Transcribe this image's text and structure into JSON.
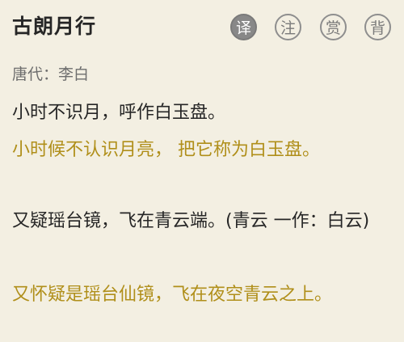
{
  "poem": {
    "title": "古朗月行",
    "author_line": "唐代：李白"
  },
  "actions": {
    "translate": "译",
    "annotate": "注",
    "appreciate": "赏",
    "recite": "背"
  },
  "stanzas": [
    {
      "verse": "小时不识月，呼作白玉盘。",
      "translation": "小时候不认识月亮， 把它称为白玉盘。"
    },
    {
      "verse": "又疑瑶台镜，飞在青云端。(青云 一作：白云)",
      "translation": "又怀疑是瑶台仙镜，飞在夜空青云之上。"
    }
  ],
  "colors": {
    "background": "#f3efe2",
    "translation_text": "#b08f1a",
    "active_button": "#888888"
  }
}
